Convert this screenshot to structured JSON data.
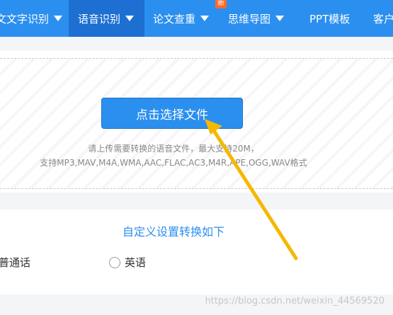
{
  "nav": {
    "items": [
      {
        "label": "文文字识别",
        "caret": true
      },
      {
        "label": "语音识别",
        "caret": true,
        "active": true
      },
      {
        "label": "论文查重",
        "caret": true,
        "badge": "新"
      },
      {
        "label": "思维导图",
        "caret": true
      },
      {
        "label": "PPT模板",
        "caret": false
      },
      {
        "label": "客户",
        "caret": false
      }
    ]
  },
  "upload": {
    "button_label": "点击选择文件",
    "hint_line1": "请上传需要转换的语音文件，最大支持20M，",
    "hint_line2": "支持MP3,MAV,M4A,WMA,AAC,FLAC,AC3,M4R,APE,OGG,WAV格式"
  },
  "settings": {
    "title": "自定义设置转换如下",
    "options": [
      {
        "label": "普通话"
      },
      {
        "label": "英语"
      }
    ]
  },
  "watermark": "https://blog.csdn.net/weixin_44569520",
  "colors": {
    "nav": "#2b8fef",
    "nav_active": "#1d6fd2",
    "arrow": "#f5b800",
    "badge": "#ff6a2a"
  }
}
